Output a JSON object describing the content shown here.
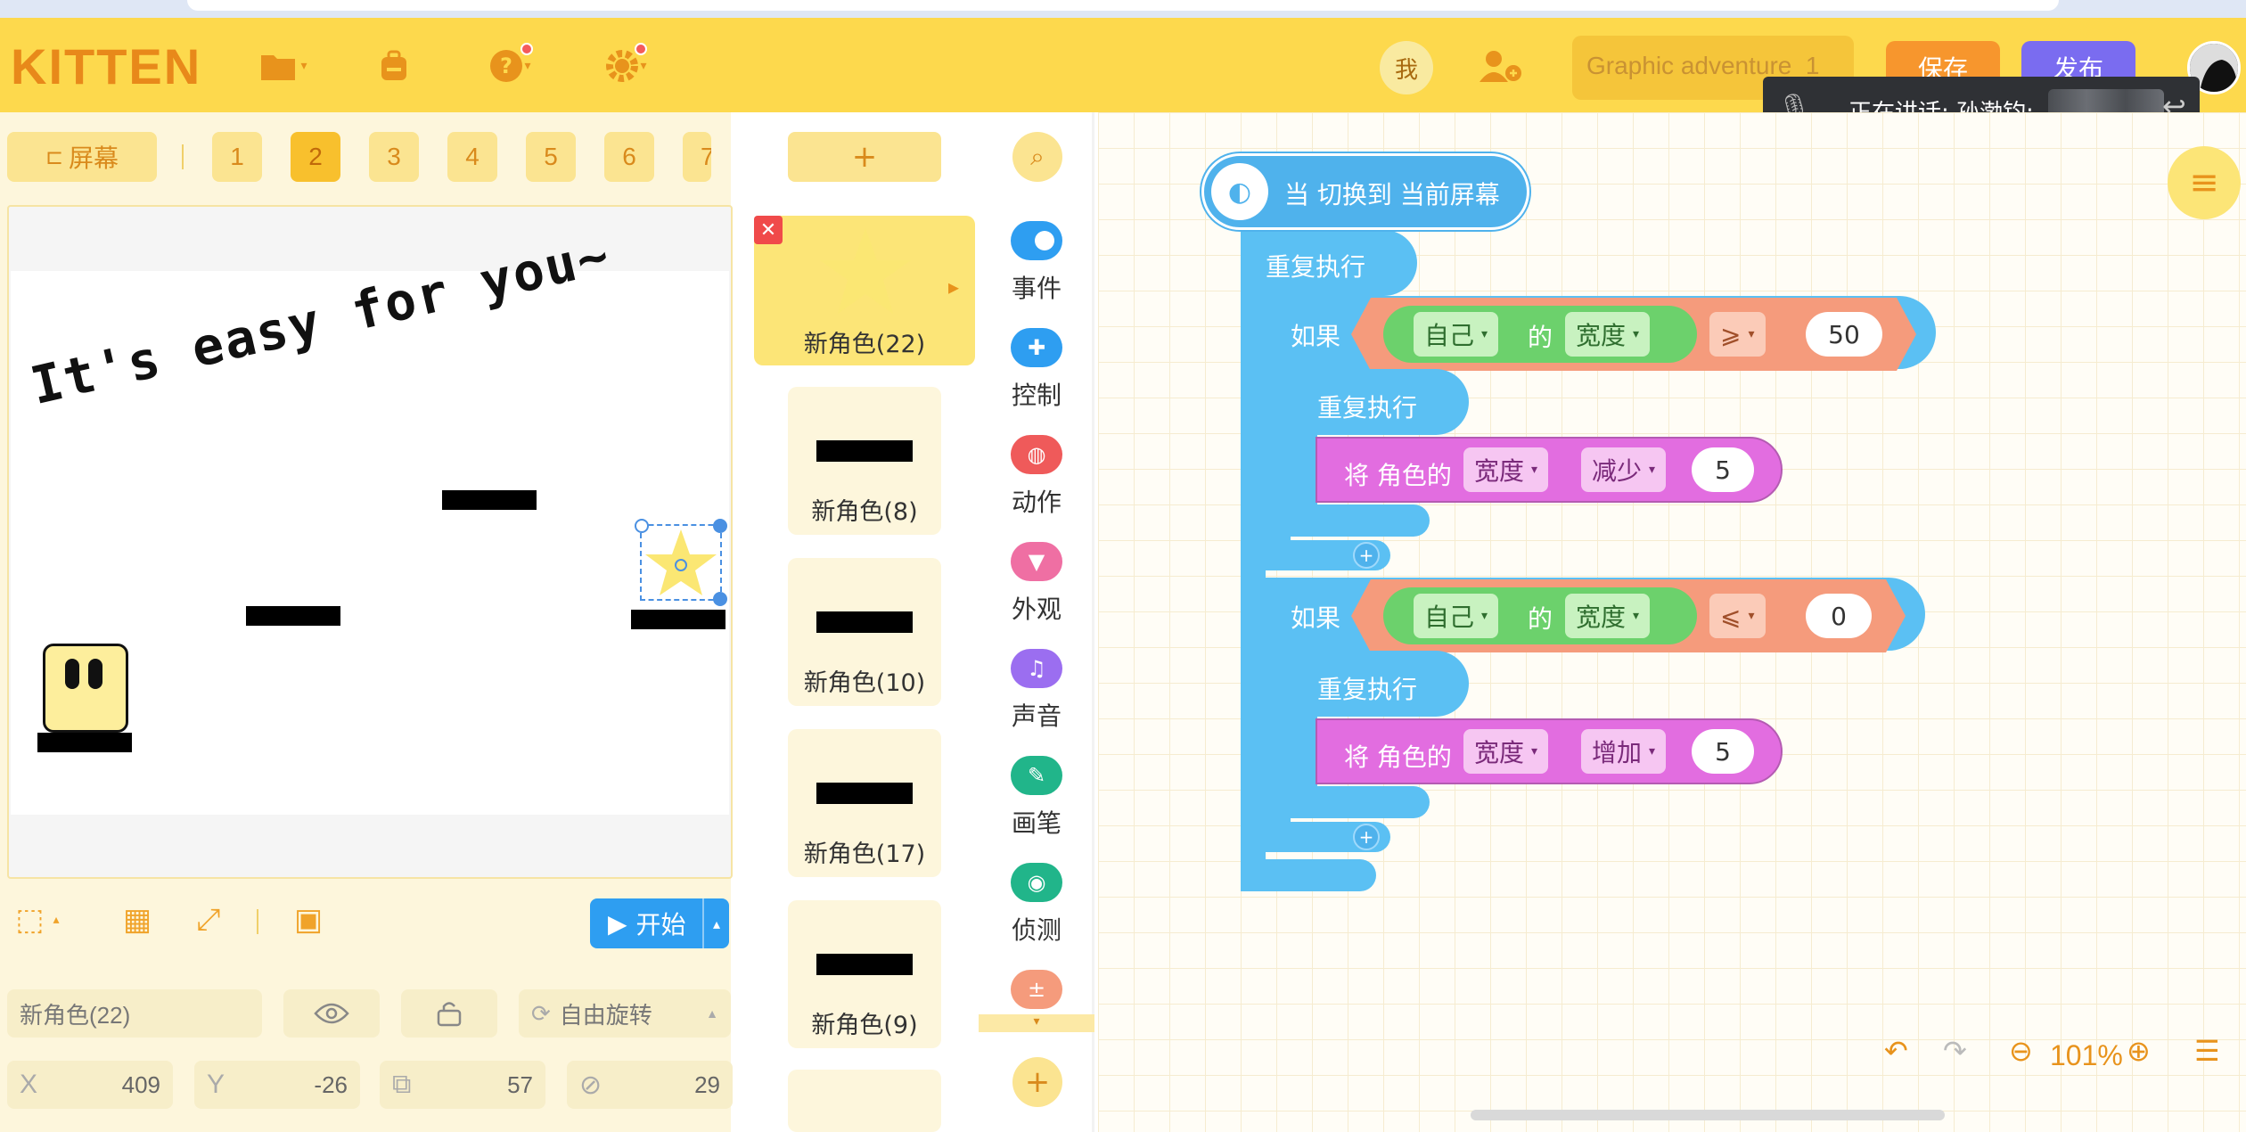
{
  "app": {
    "logo": "KITTEN"
  },
  "header": {
    "me_label": "我",
    "project_title": "Graphic adventure_1",
    "save_label": "保存",
    "publish_label": "发布"
  },
  "speaking": {
    "text": "正在讲话: 孙渤钧;"
  },
  "screens": {
    "screen_button": "屏幕",
    "tabs": [
      "1",
      "2",
      "3",
      "4",
      "5",
      "6",
      "7"
    ],
    "active_tab": "2"
  },
  "stage": {
    "text": "It's easy for you~",
    "start_label": "开始"
  },
  "sprite_props": {
    "name": "新角色(22)",
    "rotation_mode": "自由旋转",
    "x_label": "X",
    "x_value": "409",
    "y_label": "Y",
    "y_value": "-26",
    "size_value": "57",
    "direction_value": "29"
  },
  "sprites": {
    "add_label": "+",
    "items": [
      "新角色(22)",
      "新角色(8)",
      "新角色(10)",
      "新角色(17)",
      "新角色(9)"
    ]
  },
  "categories": [
    {
      "label": "事件",
      "color": "#2e9ef1",
      "icon": "toggle-icon"
    },
    {
      "label": "控制",
      "color": "#2e9ef1",
      "icon": "gamepad-icon"
    },
    {
      "label": "动作",
      "color": "#ef5a5a",
      "icon": "ghost-icon"
    },
    {
      "label": "外观",
      "color": "#ef6fa3",
      "icon": "shirt-icon"
    },
    {
      "label": "声音",
      "color": "#9b6ef0",
      "icon": "music-icon"
    },
    {
      "label": "画笔",
      "color": "#21b58a",
      "icon": "brush-icon"
    },
    {
      "label": "侦测",
      "color": "#21b58a",
      "icon": "target-icon"
    }
  ],
  "code": {
    "hat": "当 切换到 当前屏幕",
    "repeat": "重复执行",
    "if1": {
      "label": "如果",
      "obj": "自己",
      "of": "的",
      "prop": "宽度",
      "op": "⩾",
      "value": "50",
      "loop": "重复执行",
      "action": {
        "prefix": "将 角色的",
        "prop": "宽度",
        "verb": "减少",
        "value": "5"
      }
    },
    "if2": {
      "label": "如果",
      "obj": "自己",
      "of": "的",
      "prop": "宽度",
      "op": "⩽",
      "value": "0",
      "loop": "重复执行",
      "action": {
        "prefix": "将 角色的",
        "prop": "宽度",
        "verb": "增加",
        "value": "5"
      }
    }
  },
  "workspace": {
    "zoom": "101%"
  },
  "colors": {
    "header": "#fdd94d",
    "accent": "#e8931c",
    "control_block": "#5bc0f3",
    "motion_block": "#e26de0",
    "operator": "#f59b7c"
  }
}
